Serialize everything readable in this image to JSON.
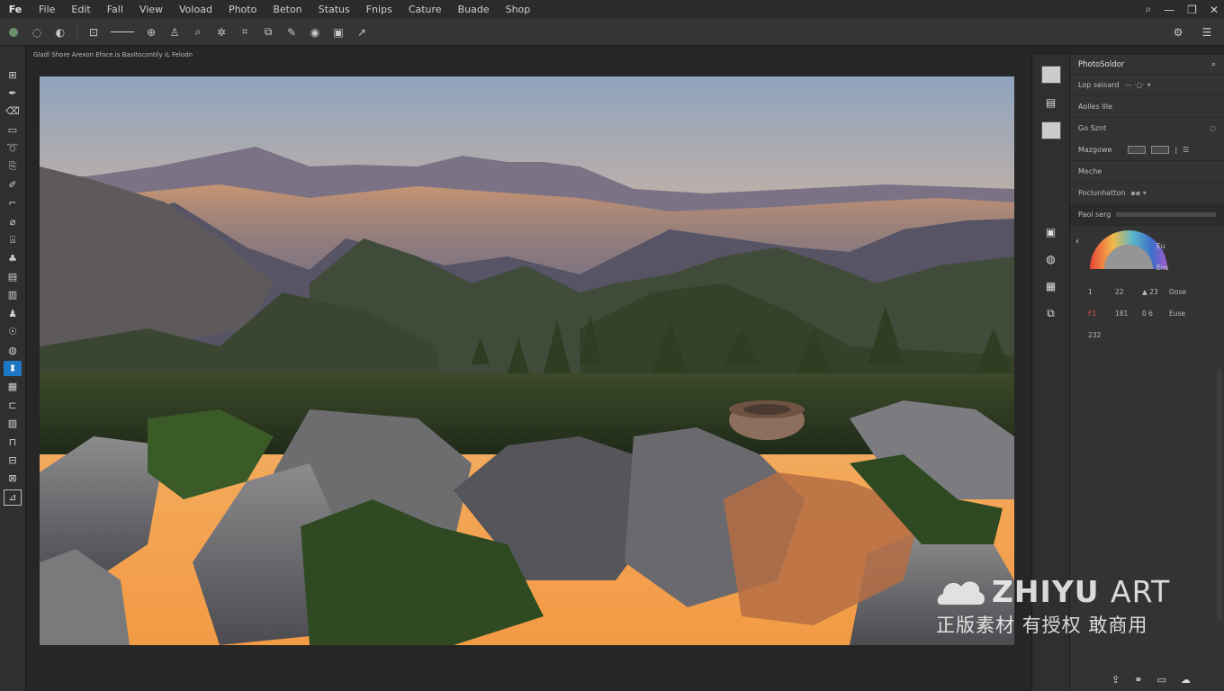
{
  "menubar": {
    "logo": "Fe",
    "items": [
      "File",
      "Edit",
      "Fall",
      "View",
      "Voload",
      "Photo",
      "Beton",
      "Status",
      "Fnips",
      "Cature",
      "Buade",
      "Shop"
    ]
  },
  "document": {
    "tab_title": "Gladl Shore Arexon Efoce.is Basitocontily iL Felodn"
  },
  "panel": {
    "title": "PhotoSoldor",
    "rows": [
      {
        "label": "Lop seisard",
        "control": "—  ·○·  ▾"
      },
      {
        "label": "Aolles Ille",
        "control": ""
      },
      {
        "label": "Go Sznt",
        "control": "○"
      },
      {
        "label": "Mazgowe",
        "control": ""
      },
      {
        "label": "Meche",
        "control": ""
      },
      {
        "label": "Poclunhatton",
        "control": "▪▪ ▾"
      },
      {
        "label": "Paol serg",
        "control": ""
      }
    ],
    "color_labels": {
      "top": "Eu",
      "mid": "Ens"
    },
    "grid": [
      [
        "1",
        "22",
        "▲ 23",
        "Oose"
      ],
      [
        "F1",
        "181",
        "0 6",
        "Euse"
      ],
      [
        "232",
        "",
        "",
        ""
      ]
    ]
  },
  "watermark": {
    "brand": "ZHIYU",
    "brand2": "ART",
    "sub": "正版素材 有授权 敢商用"
  },
  "colors": {
    "accent": "#1d77c4",
    "sky_top": "#8fa4bf",
    "sky_horizon": "#f39a45"
  }
}
